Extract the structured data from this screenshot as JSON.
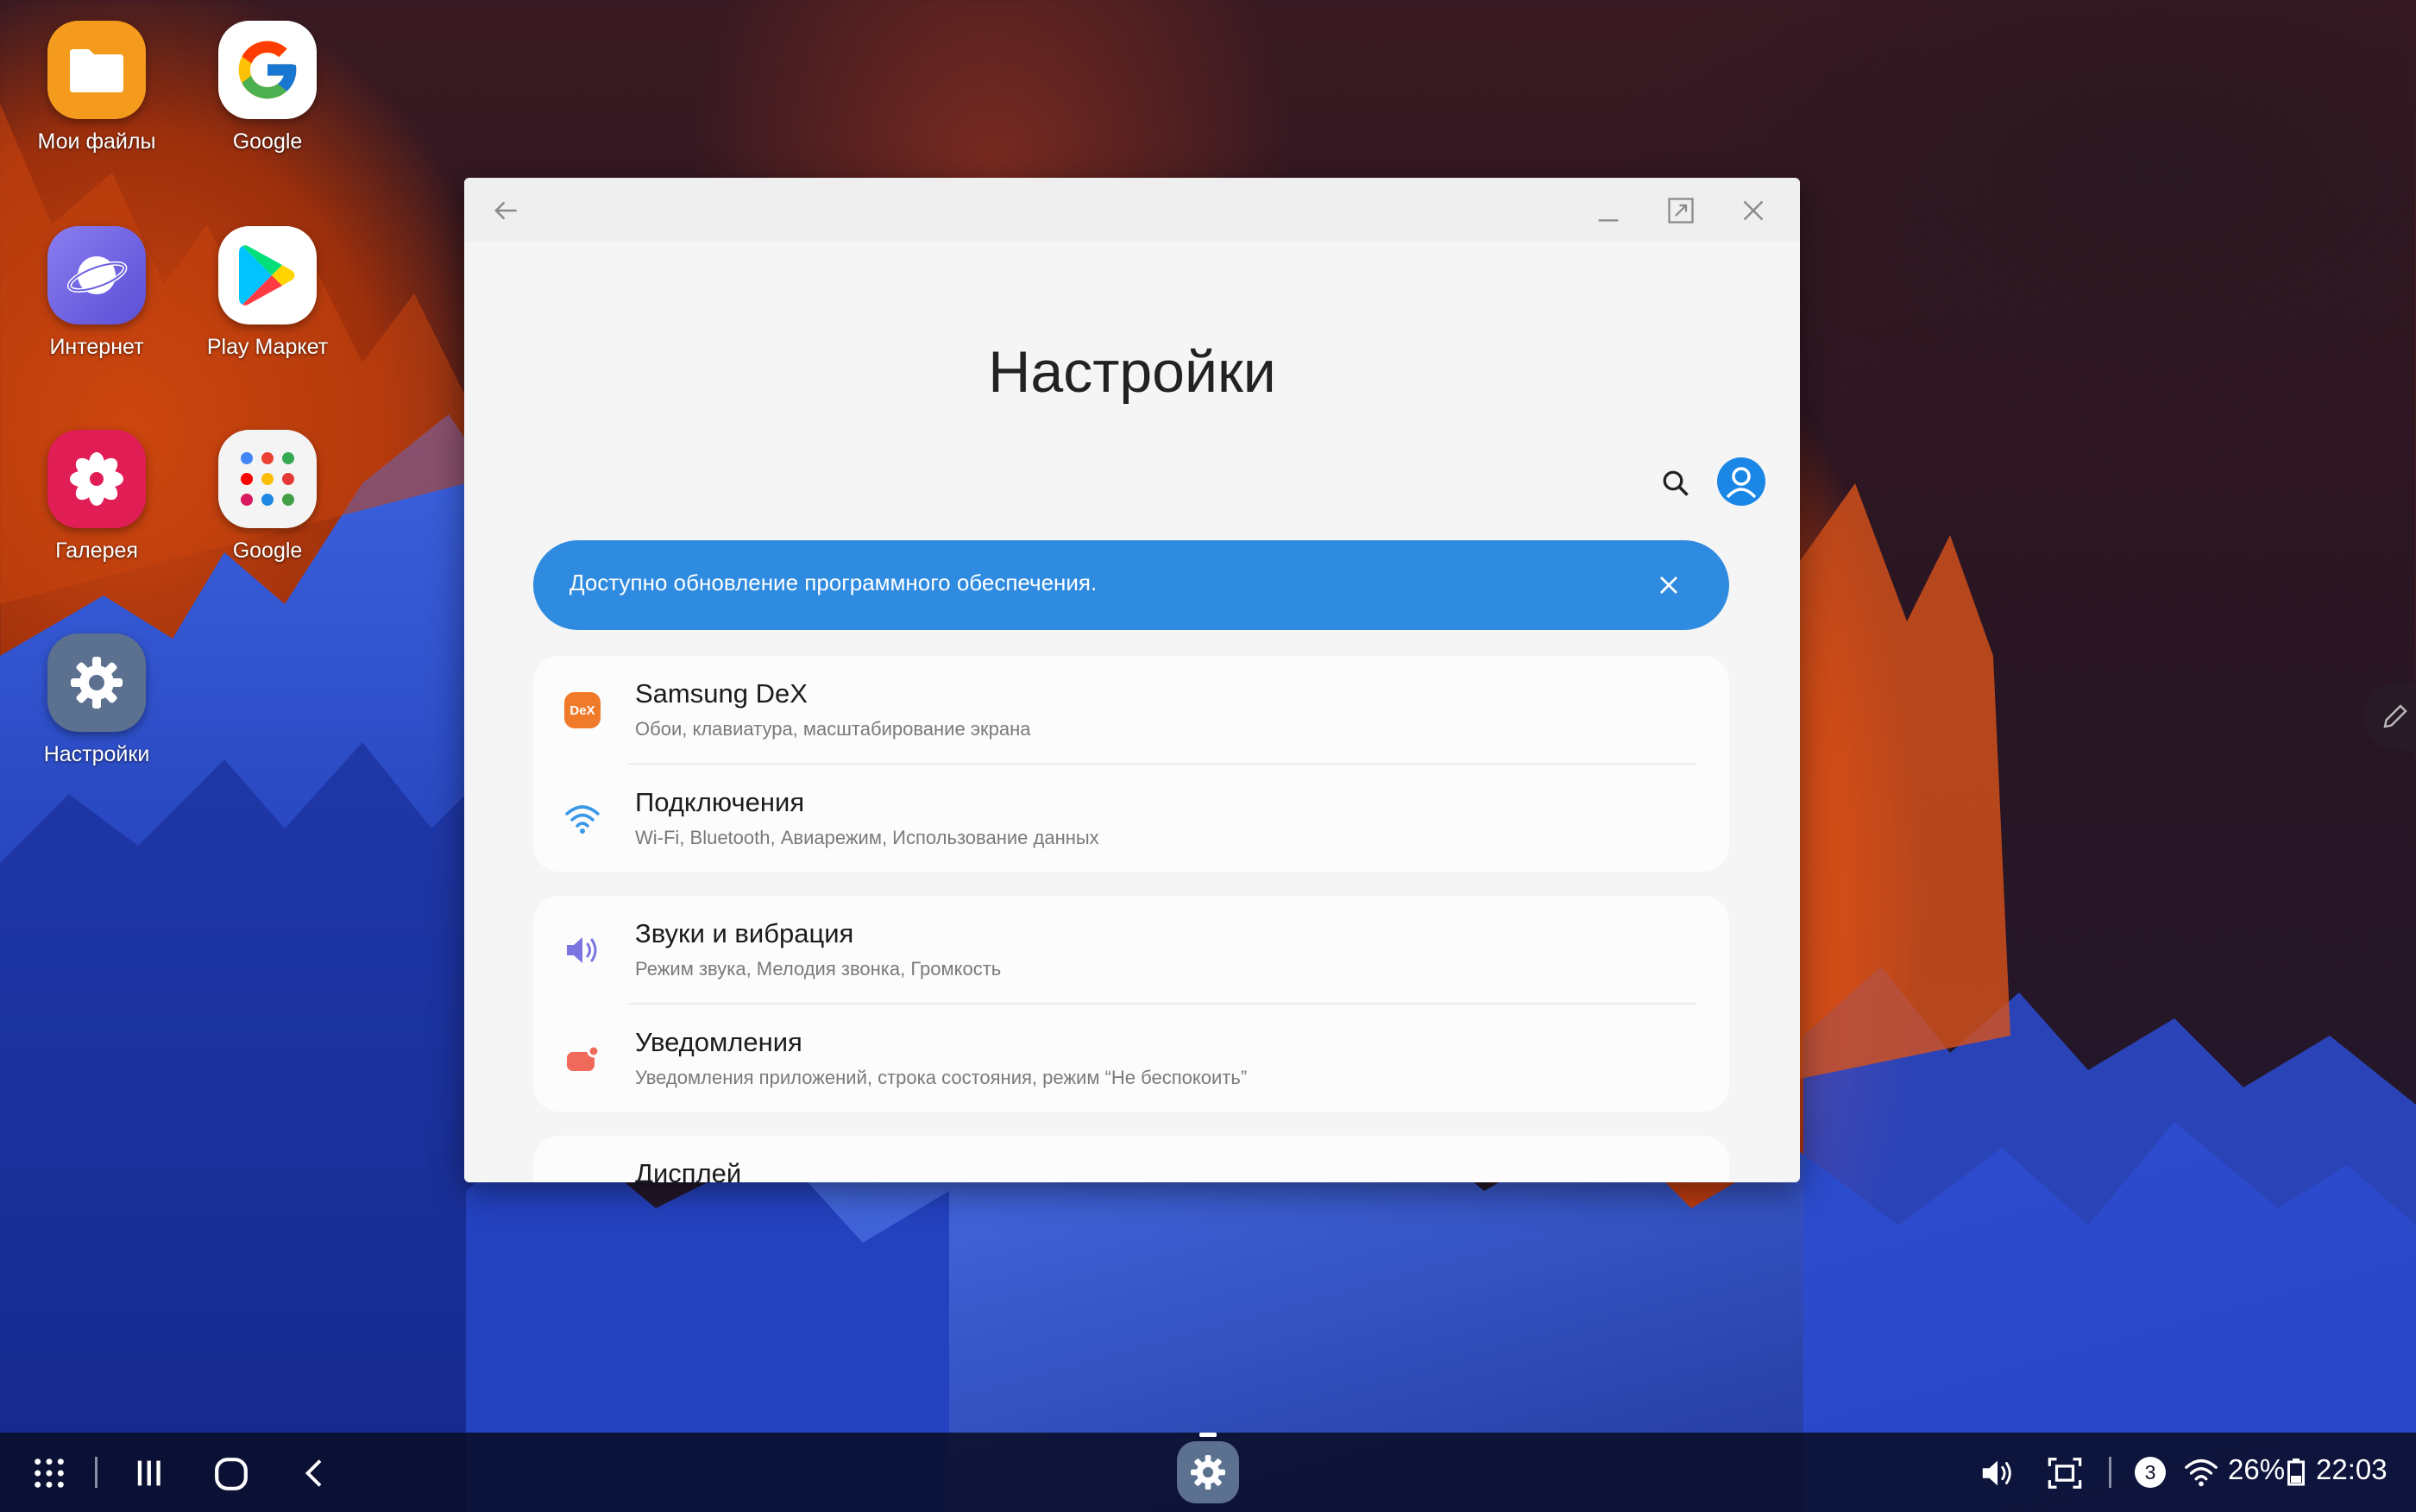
{
  "desktop": {
    "icons": [
      {
        "label": "Мои файлы"
      },
      {
        "label": "Google"
      },
      {
        "label": "Интернет"
      },
      {
        "label": "Play Маркет"
      },
      {
        "label": "Галерея"
      },
      {
        "label": "Google"
      },
      {
        "label": "Настройки"
      }
    ]
  },
  "window": {
    "title": "Настройки",
    "banner": {
      "text": "Доступно обновление программного обеспечения."
    },
    "items": [
      {
        "title": "Samsung DeX",
        "subtitle": "Обои, клавиатура, масштабирование экрана",
        "icon": "dex-icon",
        "badge": "DeX"
      },
      {
        "title": "Подключения",
        "subtitle": "Wi-Fi, Bluetooth, Авиарежим, Использование данных",
        "icon": "wifi-icon"
      },
      {
        "title": "Звуки и вибрация",
        "subtitle": "Режим звука, Мелодия звонка, Громкость",
        "icon": "speaker-icon"
      },
      {
        "title": "Уведомления",
        "subtitle": "Уведомления приложений, строка состояния, режим “Не беспокоить”",
        "icon": "notification-icon"
      },
      {
        "title": "Дисплей",
        "icon": "display-icon"
      }
    ]
  },
  "taskbar": {
    "status": {
      "notification_count": "3",
      "battery": "26%",
      "time": "22:03"
    }
  },
  "colors": {
    "accent": "#2e8be0",
    "dex_orange": "#ef7a2a",
    "taskbar_bg": "#0a0e28"
  }
}
